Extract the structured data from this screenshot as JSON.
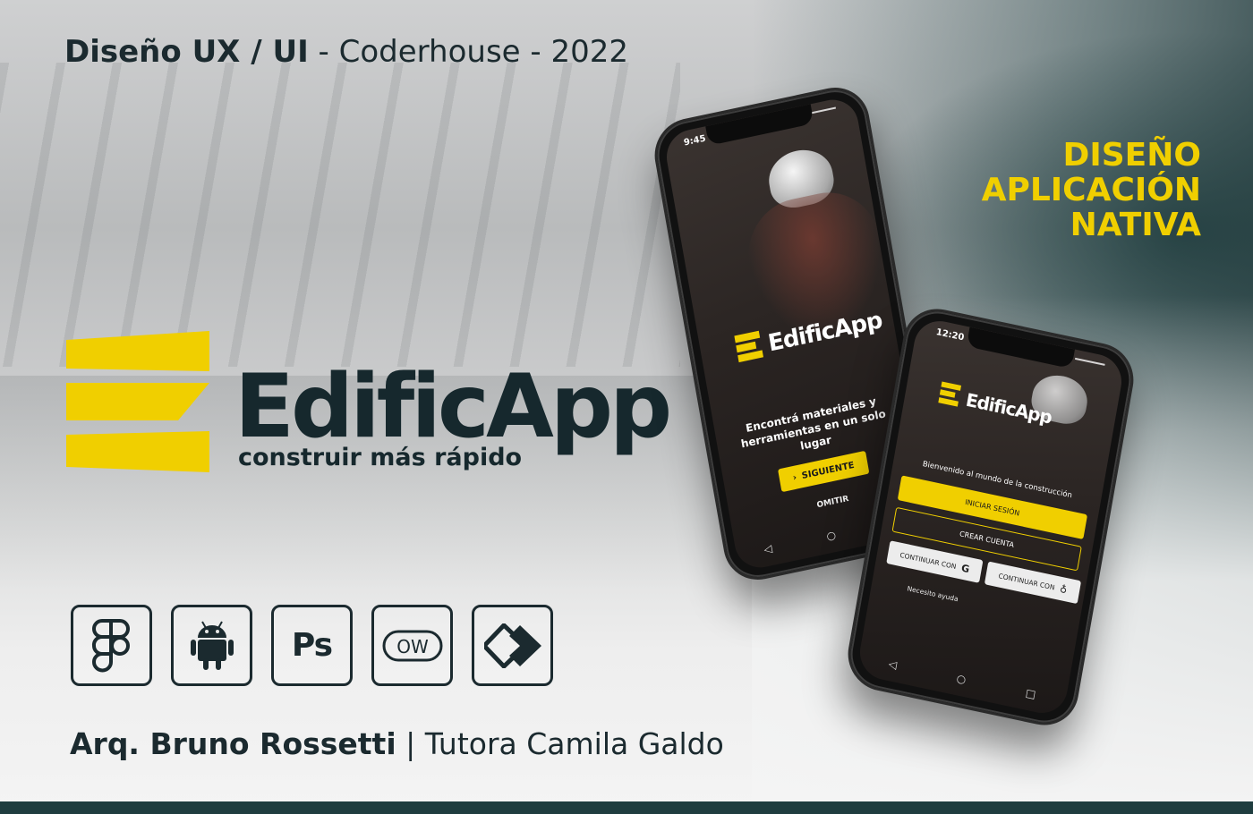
{
  "header": {
    "title_bold": "Diseño UX / UI",
    "title_rest": " - Coderhouse - 2022"
  },
  "side_title": {
    "line1": "DISEÑO",
    "line2": "APLICACIÓN",
    "line3": "NATIVA"
  },
  "brand": {
    "name": "EdificApp",
    "tagline": "construir más rápido",
    "accent_color": "#f0cf00",
    "text_color": "#16282d"
  },
  "tools": [
    {
      "name": "figma-icon"
    },
    {
      "name": "android-icon"
    },
    {
      "name": "photoshop-icon",
      "label": "Ps"
    },
    {
      "name": "ow-icon",
      "label": "OW"
    },
    {
      "name": "diamond-logo-icon"
    }
  ],
  "footer": {
    "author_bold": "Arq. Bruno Rossetti",
    "separator": " | ",
    "tutor": "Tutora Camila Galdo"
  },
  "phone_onboarding": {
    "time": "9:45",
    "app_name": "EdificApp",
    "headline": "Encontrá materiales y herramientas en un solo lugar",
    "next_button": "SIGUIENTE",
    "skip_link": "OMITIR"
  },
  "phone_login": {
    "time": "12:20",
    "app_name": "EdificApp",
    "welcome": "Bienvenido al mundo de la construcción",
    "login_button": "INICIAR SESIÓN",
    "signup_button": "CREAR CUENTA",
    "google_button": "CONTINUAR CON",
    "apple_button": "CONTINUAR CON",
    "help_link": "Necesito ayuda"
  }
}
